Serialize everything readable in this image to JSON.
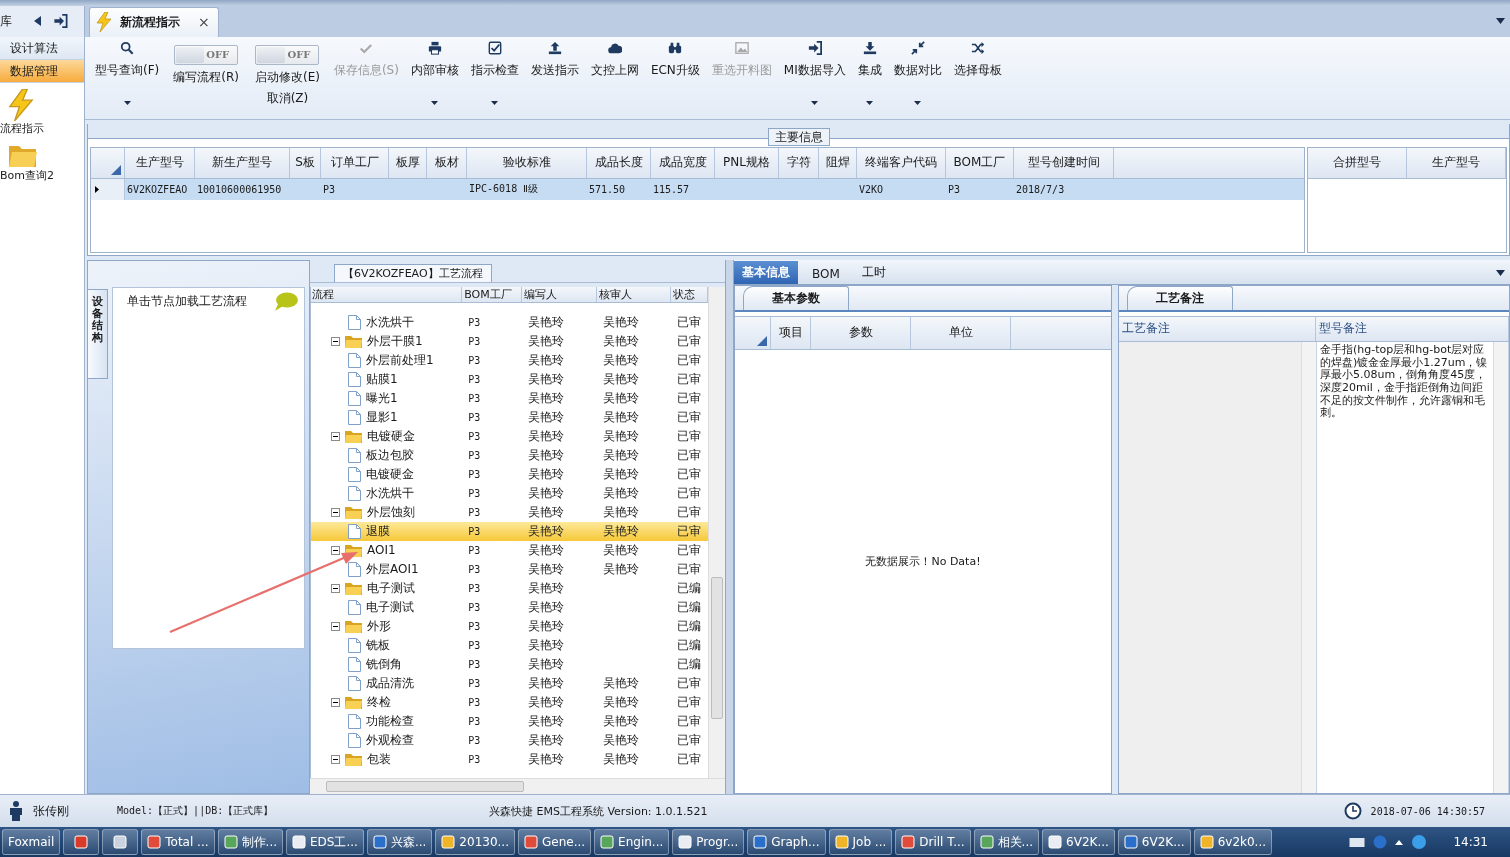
{
  "app_bar": {
    "left_label": "库",
    "tab": {
      "label": "新流程指示",
      "close": "×"
    }
  },
  "sidebar": {
    "items": [
      {
        "label": "设计算法",
        "selected": false
      },
      {
        "label": "数据管理",
        "selected": true
      }
    ],
    "launchers": [
      {
        "label": "流程指示"
      },
      {
        "label": "Bom查询2"
      }
    ]
  },
  "ribbon": {
    "items": [
      {
        "kind": "button",
        "label": "型号查询(F)",
        "dropdown": true,
        "disabled": false
      },
      {
        "kind": "toggle",
        "label": "编写流程(R)",
        "state_text": "OFF",
        "on": false
      },
      {
        "kind": "toggle",
        "label": "启动修改(E)",
        "label2": "取消(Z)",
        "state_text": "OFF",
        "on": false
      },
      {
        "kind": "button",
        "label": "保存信息(S)",
        "dropdown": false,
        "disabled": true
      },
      {
        "kind": "button",
        "label": "内部审核",
        "dropdown": true,
        "disabled": false
      },
      {
        "kind": "button",
        "label": "指示检查",
        "dropdown": true,
        "disabled": false
      },
      {
        "kind": "button",
        "label": "发送指示",
        "dropdown": false,
        "disabled": false
      },
      {
        "kind": "button",
        "label": "文控上网",
        "dropdown": false,
        "disabled": false
      },
      {
        "kind": "button",
        "label": "ECN升级",
        "dropdown": false,
        "disabled": false
      },
      {
        "kind": "button",
        "label": "重选开料图",
        "dropdown": false,
        "disabled": true
      },
      {
        "kind": "button",
        "label": "MI数据导入",
        "dropdown": true,
        "disabled": false
      },
      {
        "kind": "button",
        "label": "集成",
        "dropdown": true,
        "disabled": false
      },
      {
        "kind": "button",
        "label": "数据对比",
        "dropdown": true,
        "disabled": false
      },
      {
        "kind": "button",
        "label": "选择母板",
        "dropdown": false,
        "disabled": false
      }
    ]
  },
  "main_info": {
    "title": "主要信息",
    "columns": [
      "生产型号",
      "新生产型号",
      "S板",
      "订单工厂",
      "板厚",
      "板材",
      "验收标准",
      "成品长度",
      "成品宽度",
      "PNL规格",
      "字符",
      "阻焊",
      "终端客户代码",
      "BOM工厂",
      "型号创建时间"
    ],
    "rows": [
      {
        "selected": true,
        "cells": [
          "6V2KOZFEAO",
          "10010600061950",
          null,
          "P3",
          null,
          null,
          "IPC-6018 Ⅱ级",
          "571.50",
          "115.57",
          null,
          null,
          null,
          "V2KO",
          "P3",
          "2018/7/3"
        ]
      }
    ],
    "side_columns": [
      "合拼型号",
      "生产型号"
    ]
  },
  "structure": {
    "vertical_tab": "设备结构",
    "hint": "单击节点加载工艺流程"
  },
  "tree": {
    "title": "【6V2KOZFEAO】工艺流程",
    "columns": [
      "流程",
      "BOM工厂",
      "编写人",
      "核审人",
      "状态"
    ],
    "rows": [
      {
        "children": [
          {
            "kind": "step",
            "label": "水洗烘干",
            "bom": "P3",
            "writer": "吴艳玲",
            "reviewer": "吴艳玲",
            "status": "已审",
            "selected": false
          }
        ]
      },
      {
        "kind": "folder",
        "expanded": true,
        "label": "外层干膜1",
        "bom": "P3",
        "writer": "吴艳玲",
        "reviewer": "吴艳玲",
        "status": "已审",
        "selected": false,
        "children": [
          {
            "kind": "step",
            "label": "外层前处理1",
            "bom": "P3",
            "writer": "吴艳玲",
            "reviewer": "吴艳玲",
            "status": "已审",
            "selected": false
          },
          {
            "kind": "step",
            "label": "贴膜1",
            "bom": "P3",
            "writer": "吴艳玲",
            "reviewer": "吴艳玲",
            "status": "已审",
            "selected": false
          },
          {
            "kind": "step",
            "label": "曝光1",
            "bom": "P3",
            "writer": "吴艳玲",
            "reviewer": "吴艳玲",
            "status": "已审",
            "selected": false
          },
          {
            "kind": "step",
            "label": "显影1",
            "bom": "P3",
            "writer": "吴艳玲",
            "reviewer": "吴艳玲",
            "status": "已审",
            "selected": false
          }
        ]
      },
      {
        "kind": "folder",
        "expanded": true,
        "label": "电镀硬金",
        "bom": "P3",
        "writer": "吴艳玲",
        "reviewer": "吴艳玲",
        "status": "已审",
        "selected": false,
        "children": [
          {
            "kind": "step",
            "label": "板边包胶",
            "bom": "P3",
            "writer": "吴艳玲",
            "reviewer": "吴艳玲",
            "status": "已审",
            "selected": false
          },
          {
            "kind": "step",
            "label": "电镀硬金",
            "bom": "P3",
            "writer": "吴艳玲",
            "reviewer": "吴艳玲",
            "status": "已审",
            "selected": false
          },
          {
            "kind": "step",
            "label": "水洗烘干",
            "bom": "P3",
            "writer": "吴艳玲",
            "reviewer": "吴艳玲",
            "status": "已审",
            "selected": false
          }
        ]
      },
      {
        "kind": "folder",
        "expanded": true,
        "label": "外层蚀刻",
        "bom": "P3",
        "writer": "吴艳玲",
        "reviewer": "吴艳玲",
        "status": "已审",
        "selected": false,
        "children": [
          {
            "kind": "step",
            "label": "退膜",
            "bom": "P3",
            "writer": "吴艳玲",
            "reviewer": "吴艳玲",
            "status": "已审",
            "selected": true
          }
        ]
      },
      {
        "kind": "folder",
        "expanded": true,
        "label": "AOI1",
        "bom": "P3",
        "writer": "吴艳玲",
        "reviewer": "吴艳玲",
        "status": "已审",
        "selected": false,
        "children": [
          {
            "kind": "step",
            "label": "外层AOI1",
            "bom": "P3",
            "writer": "吴艳玲",
            "reviewer": "吴艳玲",
            "status": "已审",
            "selected": false
          }
        ]
      },
      {
        "kind": "folder",
        "expanded": true,
        "label": "电子测试",
        "bom": "P3",
        "writer": "吴艳玲",
        "status": "已编",
        "selected": false,
        "children": [
          {
            "kind": "step",
            "label": "电子测试",
            "bom": "P3",
            "writer": "吴艳玲",
            "status": "已编",
            "selected": false
          }
        ]
      },
      {
        "kind": "folder",
        "expanded": true,
        "label": "外形",
        "bom": "P3",
        "writer": "吴艳玲",
        "status": "已编",
        "selected": false,
        "children": [
          {
            "kind": "step",
            "label": "铣板",
            "bom": "P3",
            "writer": "吴艳玲",
            "status": "已编",
            "selected": false
          },
          {
            "kind": "step",
            "label": "铣倒角",
            "bom": "P3",
            "writer": "吴艳玲",
            "status": "已编",
            "selected": false
          },
          {
            "kind": "step",
            "label": "成品清洗",
            "bom": "P3",
            "writer": "吴艳玲",
            "reviewer": "吴艳玲",
            "status": "已审",
            "selected": false
          }
        ]
      },
      {
        "kind": "folder",
        "expanded": true,
        "label": "终检",
        "bom": "P3",
        "writer": "吴艳玲",
        "reviewer": "吴艳玲",
        "status": "已审",
        "selected": false,
        "children": [
          {
            "kind": "step",
            "label": "功能检查",
            "bom": "P3",
            "writer": "吴艳玲",
            "reviewer": "吴艳玲",
            "status": "已审",
            "selected": false
          },
          {
            "kind": "step",
            "label": "外观检查",
            "bom": "P3",
            "writer": "吴艳玲",
            "reviewer": "吴艳玲",
            "status": "已审",
            "selected": false
          }
        ]
      },
      {
        "kind": "folder",
        "expanded": true,
        "label": "包装",
        "bom": "P3",
        "writer": "吴艳玲",
        "reviewer": "吴艳玲",
        "status": "已审",
        "selected": false
      }
    ]
  },
  "detail": {
    "tabs": [
      {
        "label": "基本信息",
        "selected": true
      },
      {
        "label": "BOM",
        "selected": false
      },
      {
        "label": "工时",
        "selected": false
      }
    ],
    "params": {
      "tab": "基本参数",
      "columns": [
        "项目",
        "参数",
        "单位"
      ],
      "empty_text": "无数据展示！No Data!"
    },
    "notes": {
      "tab": "工艺备注",
      "columns": [
        "工艺备注",
        "型号备注"
      ],
      "model_note": "金手指(hg-top层和hg-bot层对应的焊盘)镀金金厚最小1.27um，镍厚最小5.08um，倒角角度45度，深度20mil，金手指距倒角边间距不足的按文件制作，允许露铜和毛刺。"
    }
  },
  "status_bar": {
    "user": "张传刚",
    "env": "Model:【正式】||DB:【正式库】",
    "app": "兴森快捷 EMS工程系统 Version: 1.0.1.521",
    "datetime": "2018-07-06 14:30:57"
  },
  "taskbar": {
    "items": [
      {
        "kind": "app",
        "label": "Foxmail"
      },
      {
        "kind": "icon"
      },
      {
        "kind": "icon"
      },
      {
        "kind": "app",
        "label": "Total ..."
      },
      {
        "kind": "app",
        "label": "制作..."
      },
      {
        "kind": "app",
        "label": "EDS工..."
      },
      {
        "kind": "app",
        "label": "兴森..."
      },
      {
        "kind": "app",
        "label": "20130..."
      },
      {
        "kind": "app",
        "label": "Gene..."
      },
      {
        "kind": "app",
        "label": "Engin..."
      },
      {
        "kind": "app",
        "label": "Progr..."
      },
      {
        "kind": "app",
        "label": "Graph..."
      },
      {
        "kind": "app",
        "label": "Job ..."
      },
      {
        "kind": "app",
        "label": "Drill T..."
      },
      {
        "kind": "app",
        "label": "相关..."
      },
      {
        "kind": "app",
        "label": "6V2K..."
      },
      {
        "kind": "app",
        "label": "6V2K..."
      },
      {
        "kind": "app",
        "label": "6v2k0..."
      }
    ],
    "clock": "14:31"
  }
}
